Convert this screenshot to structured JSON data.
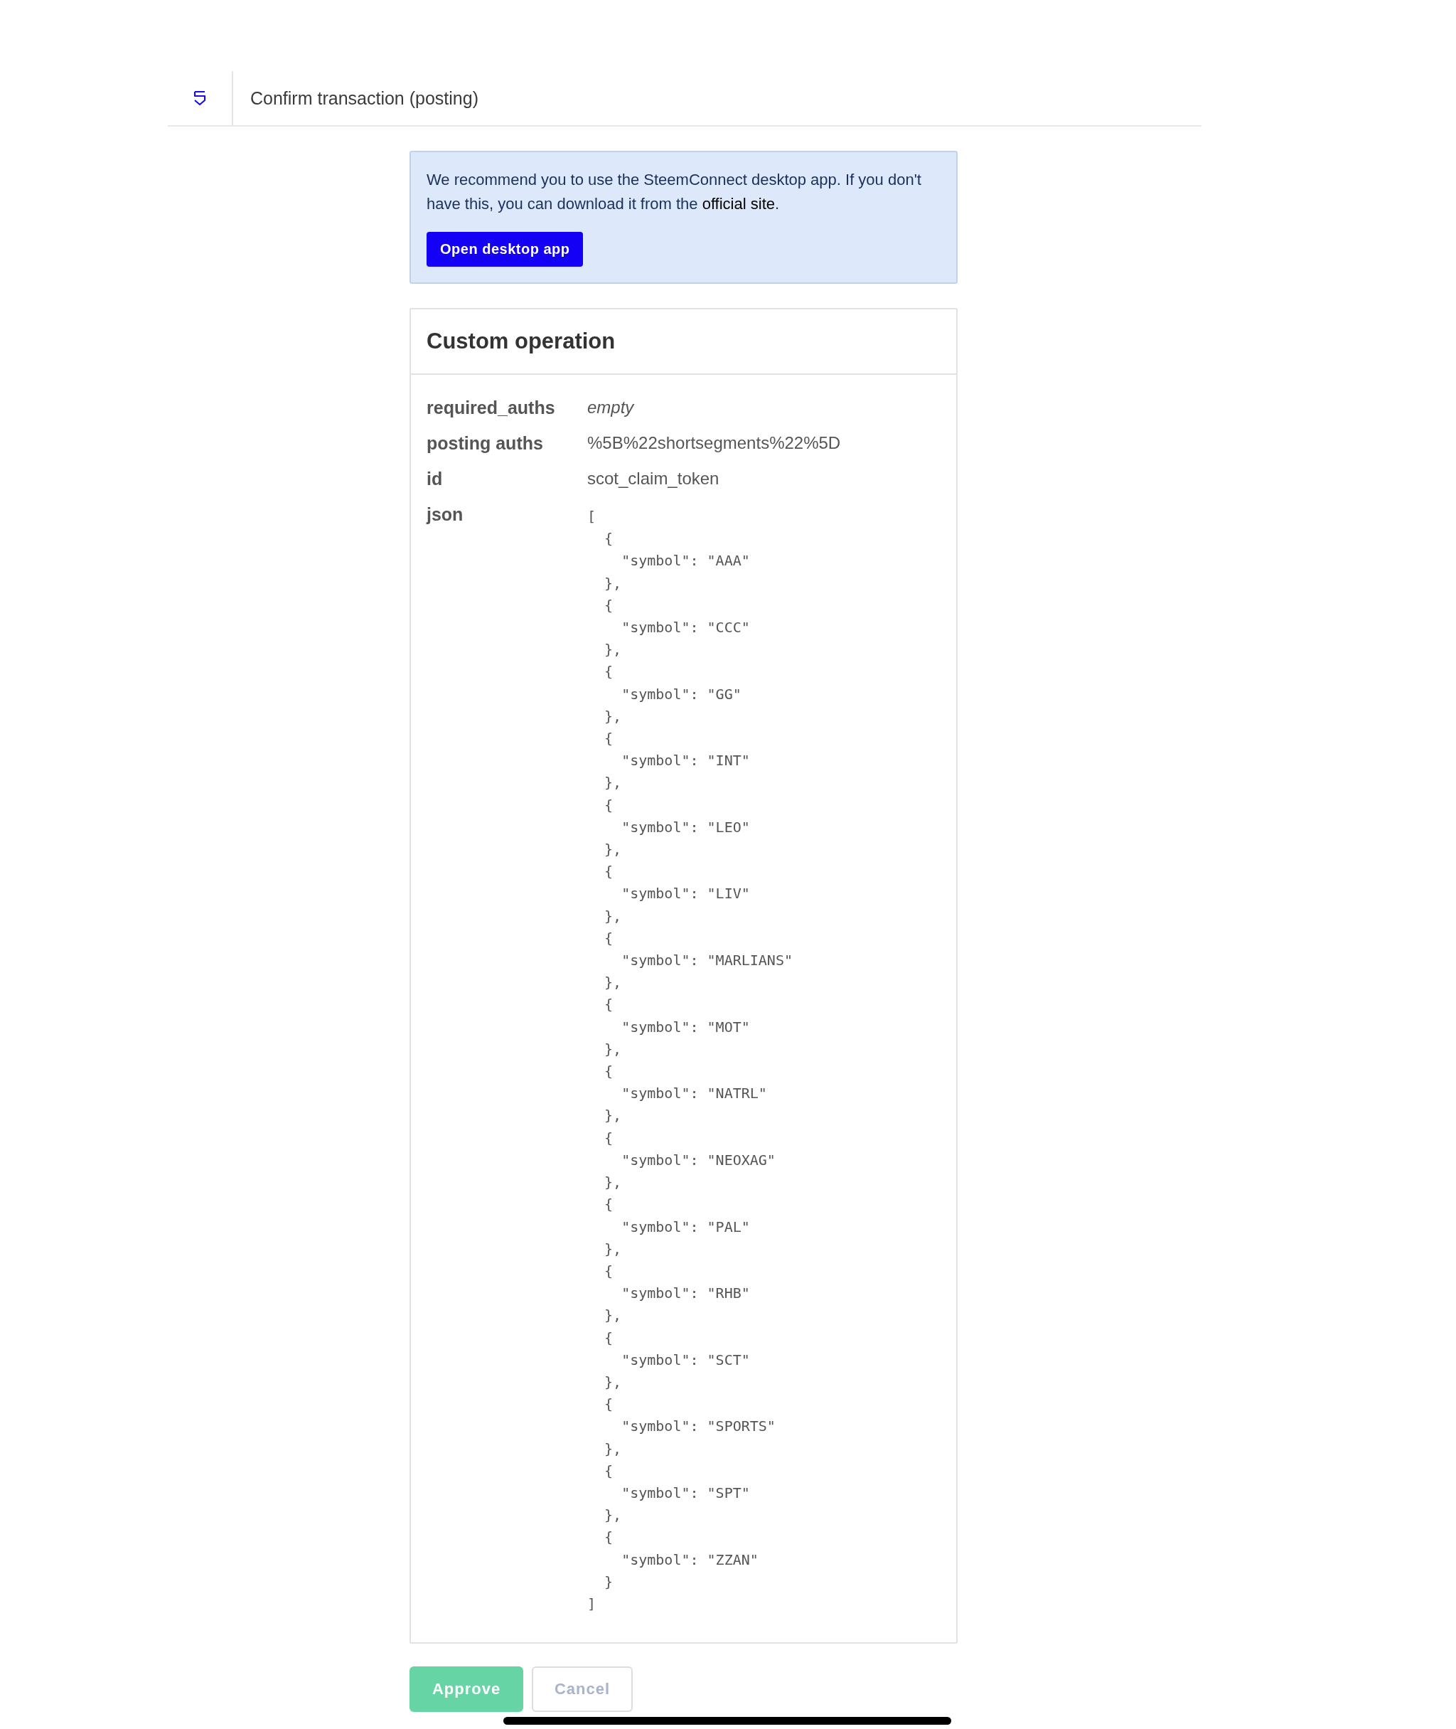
{
  "header": {
    "title": "Confirm transaction (posting)"
  },
  "notice": {
    "text": "We recommend you to use the SteemConnect desktop app. If you don't have this, you can download it from the ",
    "link": "official site",
    "after": ".",
    "button": "Open desktop app"
  },
  "operation": {
    "title": "Custom operation",
    "fields": [
      {
        "label": "required_auths",
        "value": "empty",
        "kind": "empty"
      },
      {
        "label": "posting auths",
        "value": "%5B%22shortsegments%22%5D",
        "kind": "text"
      },
      {
        "label": "id",
        "value": "scot_claim_token",
        "kind": "text"
      },
      {
        "label": "json",
        "value": "[\n  {\n    \"symbol\": \"AAA\"\n  },\n  {\n    \"symbol\": \"CCC\"\n  },\n  {\n    \"symbol\": \"GG\"\n  },\n  {\n    \"symbol\": \"INT\"\n  },\n  {\n    \"symbol\": \"LEO\"\n  },\n  {\n    \"symbol\": \"LIV\"\n  },\n  {\n    \"symbol\": \"MARLIANS\"\n  },\n  {\n    \"symbol\": \"MOT\"\n  },\n  {\n    \"symbol\": \"NATRL\"\n  },\n  {\n    \"symbol\": \"NEOXAG\"\n  },\n  {\n    \"symbol\": \"PAL\"\n  },\n  {\n    \"symbol\": \"RHB\"\n  },\n  {\n    \"symbol\": \"SCT\"\n  },\n  {\n    \"symbol\": \"SPORTS\"\n  },\n  {\n    \"symbol\": \"SPT\"\n  },\n  {\n    \"symbol\": \"ZZAN\"\n  }\n]",
        "kind": "code"
      }
    ]
  },
  "actions": [
    {
      "label": "Approve",
      "kind": "primary",
      "disabled": true
    },
    {
      "label": "Cancel",
      "kind": "secondary",
      "disabled": true
    }
  ]
}
